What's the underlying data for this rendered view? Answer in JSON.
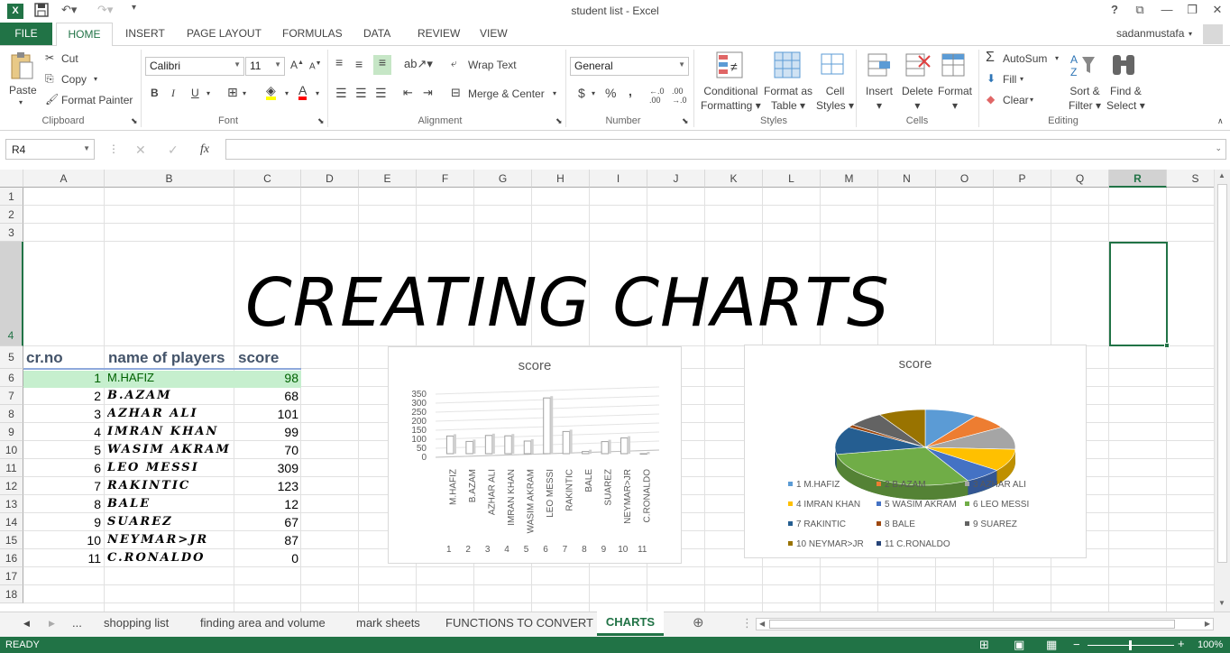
{
  "window": {
    "title": "student list - Excel",
    "user": "sadanmustafa"
  },
  "ribbon": {
    "tabs": [
      "FILE",
      "HOME",
      "INSERT",
      "PAGE LAYOUT",
      "FORMULAS",
      "DATA",
      "REVIEW",
      "VIEW"
    ],
    "clipboard": {
      "paste": "Paste",
      "cut": "Cut",
      "copy": "Copy",
      "format_painter": "Format Painter",
      "label": "Clipboard"
    },
    "font": {
      "name": "Calibri",
      "size": "11",
      "bold": "B",
      "italic": "I",
      "underline": "U",
      "label": "Font"
    },
    "alignment": {
      "wrap_text": "Wrap Text",
      "merge_center": "Merge & Center",
      "label": "Alignment"
    },
    "number": {
      "format": "General",
      "currency": "$",
      "percent": "%",
      "comma": ",",
      "label": "Number"
    },
    "styles": {
      "conditional": "Conditional",
      "conditional2": "Formatting",
      "format_as": "Format as",
      "format_as2": "Table",
      "cell": "Cell",
      "cell2": "Styles",
      "label": "Styles"
    },
    "cells": {
      "insert": "Insert",
      "delete": "Delete",
      "format": "Format",
      "label": "Cells"
    },
    "editing": {
      "autosum": "AutoSum",
      "fill": "Fill",
      "clear": "Clear",
      "sort": "Sort &",
      "sort2": "Filter",
      "find": "Find &",
      "find2": "Select",
      "label": "Editing"
    }
  },
  "formula_bar": {
    "name_box": "R4",
    "fx": "fx",
    "value": ""
  },
  "sheet": {
    "columns": [
      "A",
      "B",
      "C",
      "D",
      "E",
      "F",
      "G",
      "H",
      "I",
      "J",
      "K",
      "L",
      "M",
      "N",
      "O",
      "P",
      "Q",
      "R",
      "S"
    ],
    "rows": [
      "1",
      "2",
      "3",
      "4",
      "5",
      "6",
      "7",
      "8",
      "9",
      "10",
      "11",
      "12",
      "13",
      "14",
      "15",
      "16",
      "17",
      "18"
    ],
    "banner": "CREATING CHARTS",
    "headers": {
      "a": "cr.no",
      "b": "name of players",
      "c": "score"
    },
    "data": [
      {
        "no": "1",
        "name": "M.HAFIZ",
        "score": "98"
      },
      {
        "no": "2",
        "name": "B.AZAM",
        "score": "68"
      },
      {
        "no": "3",
        "name": "AZHAR ALI",
        "score": "101"
      },
      {
        "no": "4",
        "name": "IMRAN KHAN",
        "score": "99"
      },
      {
        "no": "5",
        "name": "WASIM AKRAM",
        "score": "70"
      },
      {
        "no": "6",
        "name": "LEO MESSI",
        "score": "309"
      },
      {
        "no": "7",
        "name": "RAKINTIC",
        "score": "123"
      },
      {
        "no": "8",
        "name": "BALE",
        "score": "12"
      },
      {
        "no": "9",
        "name": "SUAREZ",
        "score": "67"
      },
      {
        "no": "10",
        "name": "NEYMAR>JR",
        "score": "87"
      },
      {
        "no": "11",
        "name": "C.RONALDO",
        "score": "0"
      }
    ]
  },
  "chart_data": [
    {
      "type": "bar",
      "title": "score",
      "categories": [
        "M.HAFIZ",
        "B.AZAM",
        "AZHAR ALI",
        "IMRAN KHAN",
        "WASIM AKRAM",
        "LEO MESSI",
        "RAKINTIC",
        "BALE",
        "SUAREZ",
        "NEYMAR>JR",
        "C.RONALDO"
      ],
      "category_numbers": [
        "1",
        "2",
        "3",
        "4",
        "5",
        "6",
        "7",
        "8",
        "9",
        "10",
        "11"
      ],
      "values": [
        98,
        68,
        101,
        99,
        70,
        309,
        123,
        12,
        67,
        87,
        0
      ],
      "yticks": [
        "350",
        "300",
        "250",
        "200",
        "150",
        "100",
        "50",
        "0"
      ],
      "ylim": [
        0,
        350
      ],
      "grid": true
    },
    {
      "type": "pie",
      "title": "score",
      "labels": [
        "1 M.HAFIZ",
        "2 B.AZAM",
        "3 AZHAR ALI",
        "4 IMRAN KHAN",
        "5 WASIM AKRAM",
        "6 LEO MESSI",
        "7 RAKINTIC",
        "8 BALE",
        "9 SUAREZ",
        "10 NEYMAR>JR",
        "11 C.RONALDO"
      ],
      "values": [
        98,
        68,
        101,
        99,
        70,
        309,
        123,
        12,
        67,
        87,
        0
      ],
      "colors": [
        "#5b9bd5",
        "#ed7d31",
        "#a5a5a5",
        "#ffc000",
        "#4472c4",
        "#70ad47",
        "#255e91",
        "#9e480e",
        "#636363",
        "#997300",
        "#264478"
      ],
      "legend": "bottom"
    }
  ],
  "sheet_tabs": [
    "...",
    "shopping list",
    "finding area and volume",
    "mark sheets",
    "FUNCTIONS TO CONVERT",
    "CHARTS"
  ],
  "status": {
    "ready": "READY",
    "zoom": "100%"
  }
}
